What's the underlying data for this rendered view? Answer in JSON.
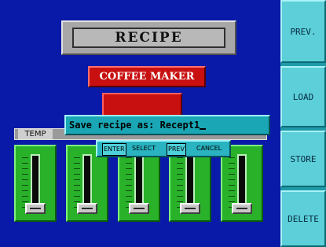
{
  "title": "RECIPE",
  "product": "COFFEE MAKER",
  "section_label": "TEMP",
  "dialog": {
    "prompt": "Save recipe as: ",
    "value": "Recept1"
  },
  "keys": {
    "enter": "ENTER",
    "select": "SELECT",
    "prev": "PREV",
    "cancel": "CANCEL"
  },
  "side_buttons": {
    "prev": "PREV.",
    "load": "LOAD",
    "store": "STORE",
    "delete": "DELETE"
  },
  "sliders": [
    {
      "level": 0
    },
    {
      "level": 0
    },
    {
      "level": 0
    },
    {
      "level": 0
    },
    {
      "level": 0
    }
  ],
  "colors": {
    "background": "#0a1aa8",
    "panel": "#5ccfd8",
    "accent_red": "#c81010",
    "slider_green": "#2ab12a"
  }
}
